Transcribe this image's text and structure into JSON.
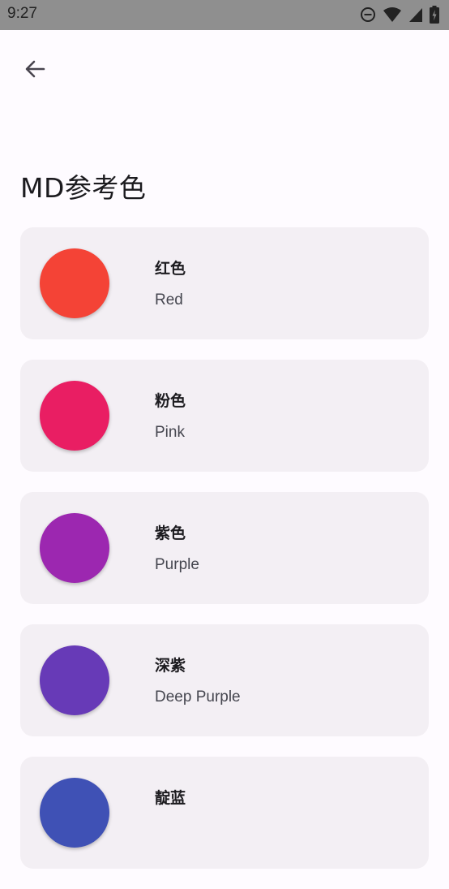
{
  "status_bar": {
    "time": "9:27",
    "icons": [
      "do-not-disturb-icon",
      "wifi-icon",
      "signal-icon",
      "battery-charging-icon"
    ]
  },
  "header": {
    "back_icon": "arrow-back-icon",
    "title": "MD参考色"
  },
  "colors": [
    {
      "name_zh": "红色",
      "name_en": "Red",
      "hex": "#f44336"
    },
    {
      "name_zh": "粉色",
      "name_en": "Pink",
      "hex": "#e91e63"
    },
    {
      "name_zh": "紫色",
      "name_en": "Purple",
      "hex": "#9c27b0"
    },
    {
      "name_zh": "深紫",
      "name_en": "Deep Purple",
      "hex": "#673ab7"
    },
    {
      "name_zh": "靛蓝",
      "name_en": "",
      "hex": "#3f51b5"
    }
  ]
}
